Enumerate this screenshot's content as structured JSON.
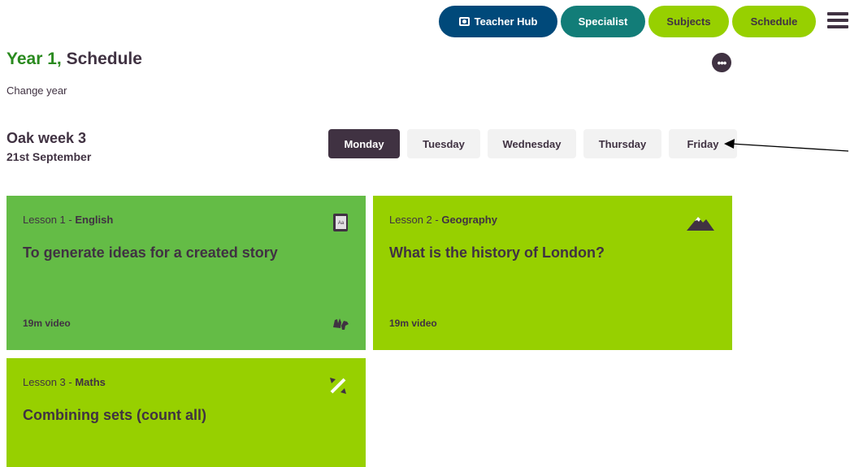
{
  "nav": {
    "teacher_hub": "Teacher Hub",
    "specialist": "Specialist",
    "subjects": "Subjects",
    "schedule": "Schedule"
  },
  "header": {
    "year": "Year 1,",
    "page": "Schedule",
    "change_year": "Change year",
    "more_label": "•••"
  },
  "week": {
    "title": "Oak week 3",
    "date": "21st September"
  },
  "days": [
    "Monday",
    "Tuesday",
    "Wednesday",
    "Thursday",
    "Friday"
  ],
  "selected_day": "Monday",
  "lessons": [
    {
      "number": "Lesson 1",
      "subject": "English",
      "title": "To generate ideas for a created story",
      "duration": "19m video",
      "icon": "dictionary-icon",
      "extra_icon": "sign-language-icon"
    },
    {
      "number": "Lesson 2",
      "subject": "Geography",
      "title": "What is the history of London?",
      "duration": "19m video",
      "icon": "mountain-icon"
    },
    {
      "number": "Lesson 3",
      "subject": "Maths",
      "title": "Combining sets (count all)",
      "icon": "percent-icon"
    }
  ],
  "colors": {
    "dark": "#403242",
    "green_english": "#64bc46",
    "lime": "#97d000",
    "navy": "#00497a",
    "teal": "#127d78"
  }
}
